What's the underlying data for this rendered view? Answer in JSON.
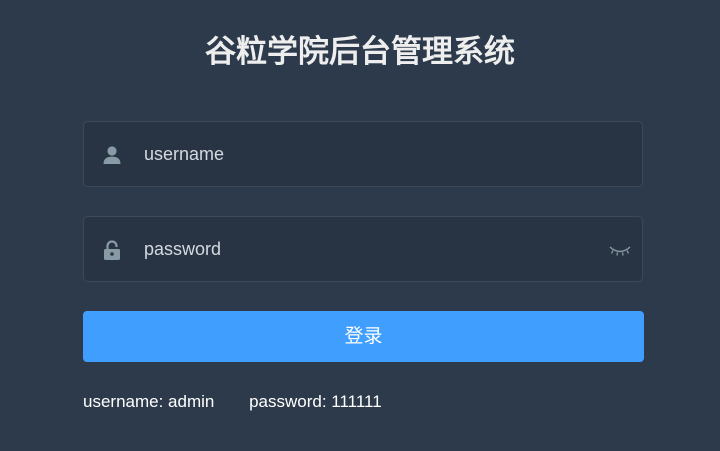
{
  "title": "谷粒学院后台管理系统",
  "username_field": {
    "placeholder": "username",
    "icon": "user-icon"
  },
  "password_field": {
    "placeholder": "password",
    "icon": "lock-icon",
    "toggle_icon": "eye-closed-icon"
  },
  "login_button": {
    "label": "登录"
  },
  "tips": {
    "username": "username: admin",
    "password": "password: 111111"
  },
  "colors": {
    "background": "#2d3a4b",
    "primary": "#409eff",
    "icon": "#889aa4"
  }
}
